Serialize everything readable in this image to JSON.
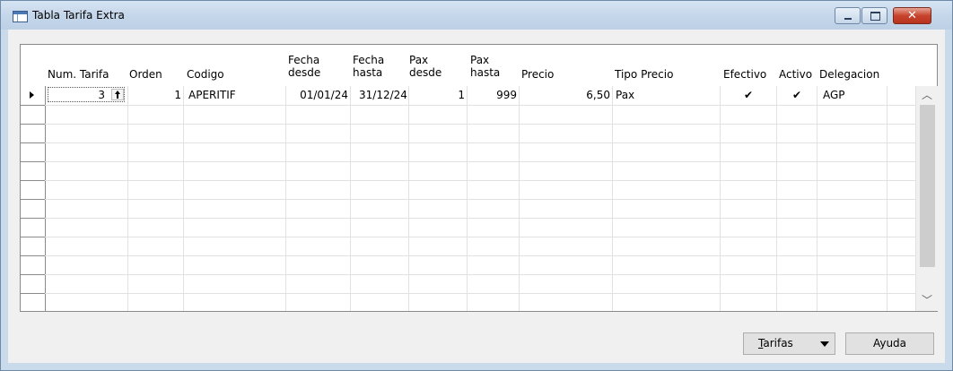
{
  "window": {
    "title": "Tabla Tarifa Extra",
    "close_glyph": "✕"
  },
  "columns": [
    {
      "line1": "",
      "line2": "Num. Tarifa"
    },
    {
      "line1": "",
      "line2": "Orden"
    },
    {
      "line1": "",
      "line2": "Codigo"
    },
    {
      "line1": "Fecha",
      "line2": "desde"
    },
    {
      "line1": "Fecha",
      "line2": "hasta"
    },
    {
      "line1": "Pax",
      "line2": "desde"
    },
    {
      "line1": "Pax",
      "line2": "hasta"
    },
    {
      "line1": "",
      "line2": "Precio"
    },
    {
      "line1": "",
      "line2": "Tipo Precio"
    },
    {
      "line1": "",
      "line2": "Efectivo"
    },
    {
      "line1": "",
      "line2": "Activo"
    },
    {
      "line1": "",
      "line2": "Delegacion"
    }
  ],
  "rows": [
    {
      "num_tarifa": "3",
      "orden": "1",
      "codigo": "APERITIF",
      "fecha_desde": "01/01/24",
      "fecha_hasta": "31/12/24",
      "pax_desde": "1",
      "pax_hasta": "999",
      "precio": "6,50",
      "tipo_precio": "Pax",
      "efectivo": "✔",
      "activo": "✔",
      "delegacion": "AGP"
    }
  ],
  "scrollbar": {
    "up_glyph": "︿",
    "down_glyph": "﹀"
  },
  "buttons": {
    "tarifas_prefix": "T",
    "tarifas_rest": "arifas",
    "ayuda": "Ayuda"
  },
  "icons": [
    "table-icon",
    "minimize-icon",
    "maximize-icon",
    "close-icon",
    "row-pointer-icon",
    "lookup-arrow-icon",
    "chevron-up-icon",
    "chevron-down-icon",
    "dropdown-arrow-icon"
  ]
}
